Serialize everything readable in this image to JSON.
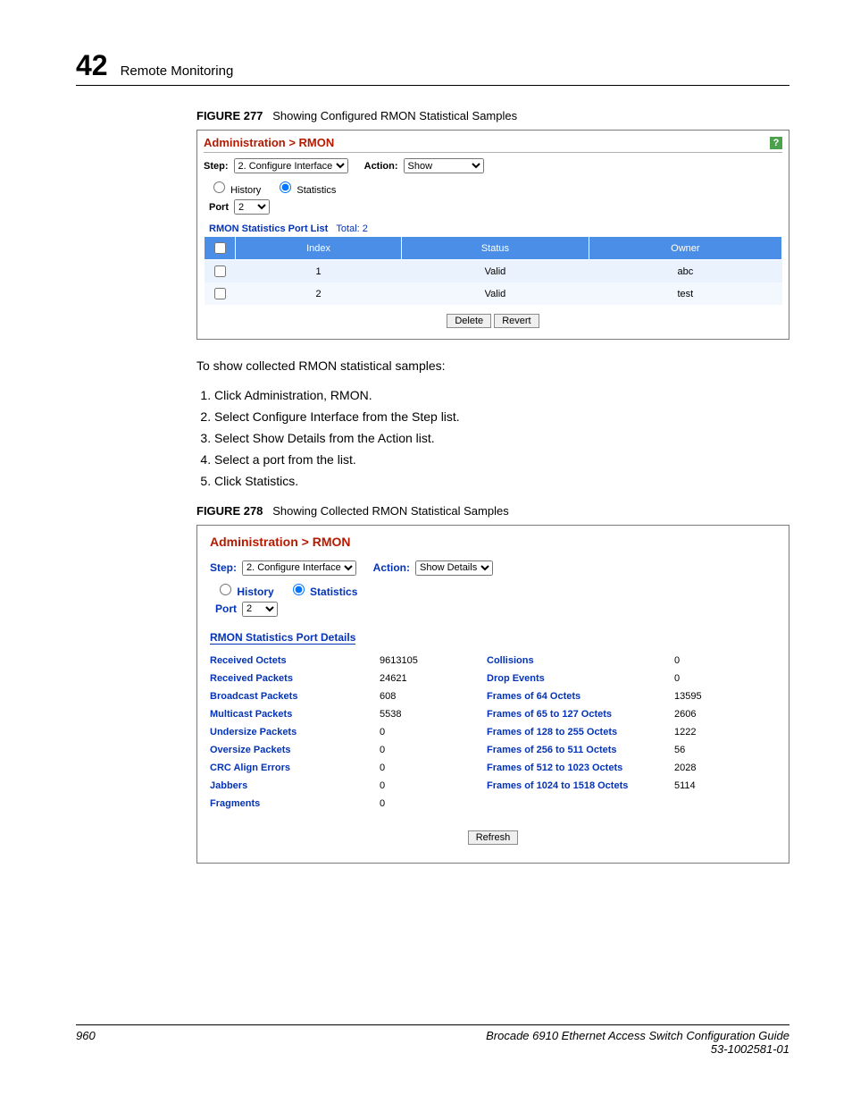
{
  "header": {
    "chapter_num": "42",
    "chapter_title": "Remote Monitoring"
  },
  "fig1": {
    "caption_label": "FIGURE 277",
    "caption_text": "Showing Configured RMON Statistical Samples",
    "breadcrumb": "Administration > RMON",
    "help": "?",
    "step_label": "Step:",
    "step_value": "2. Configure Interface",
    "action_label": "Action:",
    "action_value": "Show",
    "radio_history": "History",
    "radio_stats": "Statistics",
    "port_label": "Port",
    "port_value": "2",
    "list_title_a": "RMON Statistics Port List",
    "list_title_b": "Total: 2",
    "th_index": "Index",
    "th_status": "Status",
    "th_owner": "Owner",
    "rows": [
      {
        "idx": "1",
        "status": "Valid",
        "owner": "abc"
      },
      {
        "idx": "2",
        "status": "Valid",
        "owner": "test"
      }
    ],
    "btn_delete": "Delete",
    "btn_revert": "Revert"
  },
  "intro": "To show collected RMON statistical samples:",
  "steps": [
    "Click Administration, RMON.",
    "Select Configure Interface from the Step list.",
    "Select Show Details from the Action list.",
    "Select a port from the list.",
    "Click Statistics."
  ],
  "fig2": {
    "caption_label": "FIGURE 278",
    "caption_text": "Showing Collected RMON Statistical Samples",
    "breadcrumb": "Administration > RMON",
    "step_label": "Step:",
    "step_value": "2. Configure Interface",
    "action_label": "Action:",
    "action_value": "Show Details",
    "radio_history": "History",
    "radio_stats": "Statistics",
    "port_label": "Port",
    "port_value": "2",
    "sec_title": "RMON Statistics Port Details",
    "left": [
      {
        "lbl": "Received Octets",
        "val": "9613105"
      },
      {
        "lbl": "Received Packets",
        "val": "24621"
      },
      {
        "lbl": "Broadcast Packets",
        "val": "608"
      },
      {
        "lbl": "Multicast Packets",
        "val": "5538"
      },
      {
        "lbl": "Undersize Packets",
        "val": "0"
      },
      {
        "lbl": "Oversize Packets",
        "val": "0"
      },
      {
        "lbl": "CRC Align Errors",
        "val": "0"
      },
      {
        "lbl": "Jabbers",
        "val": "0"
      },
      {
        "lbl": "Fragments",
        "val": "0"
      }
    ],
    "right": [
      {
        "lbl": "Collisions",
        "val": "0"
      },
      {
        "lbl": "Drop Events",
        "val": "0"
      },
      {
        "lbl": "Frames of 64 Octets",
        "val": "13595"
      },
      {
        "lbl": "Frames of 65 to 127 Octets",
        "val": "2606"
      },
      {
        "lbl": "Frames of 128 to 255 Octets",
        "val": "1222"
      },
      {
        "lbl": "Frames of 256 to 511 Octets",
        "val": "56"
      },
      {
        "lbl": "Frames of 512 to 1023 Octets",
        "val": "2028"
      },
      {
        "lbl": "Frames of 1024 to 1518 Octets",
        "val": "5114"
      }
    ],
    "btn_refresh": "Refresh"
  },
  "footer": {
    "page_num": "960",
    "guide": "Brocade 6910 Ethernet Access Switch Configuration Guide",
    "docnum": "53-1002581-01"
  }
}
